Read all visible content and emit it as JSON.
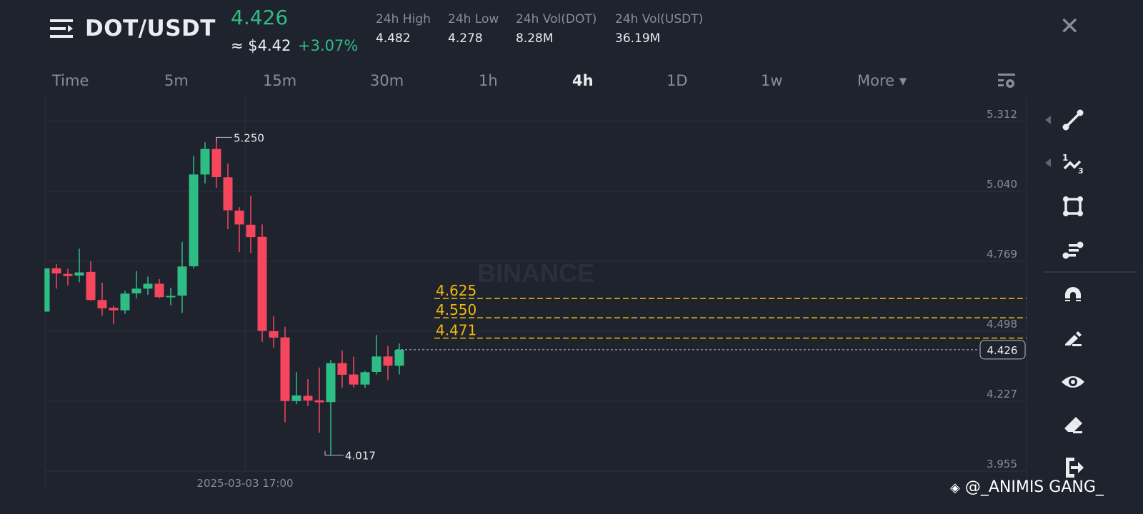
{
  "header": {
    "pair": "DOT/USDT",
    "last_price": "4.426",
    "usd_price": "≈ $4.42",
    "change_pct": "+3.07%",
    "stats": [
      {
        "label": "24h High",
        "value": "4.482"
      },
      {
        "label": "24h Low",
        "value": "4.278"
      },
      {
        "label": "24h Vol(DOT)",
        "value": "8.28M"
      },
      {
        "label": "24h Vol(USDT)",
        "value": "36.19M"
      }
    ],
    "close_label": "✕"
  },
  "tabs": [
    {
      "label": "Time"
    },
    {
      "label": "5m"
    },
    {
      "label": "15m"
    },
    {
      "label": "30m"
    },
    {
      "label": "1h"
    },
    {
      "label": "4h",
      "active": true
    },
    {
      "label": "1D"
    },
    {
      "label": "1w"
    },
    {
      "label": "More ▾"
    }
  ],
  "toolbar": [
    "trend-line",
    "fibonacci",
    "rectangle",
    "parallel-lines",
    "magnet",
    "pencil",
    "eye",
    "eraser",
    "exit"
  ],
  "watermark": {
    "logo": "BINANCE",
    "credit": "@_ANIMIS GANG_"
  },
  "colors": {
    "up": "#2ebd85",
    "down": "#f6465d",
    "level": "#f0b90b",
    "bg": "#1f232e"
  },
  "chart_data": {
    "type": "candlestick",
    "interval": "4h",
    "ylim": [
      3.955,
      5.312
    ],
    "y_ticks": [
      "5.312",
      "5.040",
      "4.769",
      "4.498",
      "4.227",
      "3.955"
    ],
    "x_label": "2025-03-03 17:00",
    "high_marker": "5.250",
    "low_marker": "4.017",
    "current_price": "4.426",
    "levels": [
      "4.625",
      "4.550",
      "4.471"
    ],
    "ohlc": [
      [
        4.574,
        4.742,
        4.574,
        4.742
      ],
      [
        4.742,
        4.758,
        4.663,
        4.722
      ],
      [
        4.72,
        4.74,
        4.675,
        4.712
      ],
      [
        4.714,
        4.818,
        4.688,
        4.726
      ],
      [
        4.728,
        4.769,
        4.617,
        4.619
      ],
      [
        4.619,
        4.686,
        4.558,
        4.587
      ],
      [
        4.589,
        4.596,
        4.525,
        4.579
      ],
      [
        4.579,
        4.655,
        4.565,
        4.644
      ],
      [
        4.645,
        4.731,
        4.625,
        4.663
      ],
      [
        4.663,
        4.71,
        4.639,
        4.682
      ],
      [
        4.682,
        4.7,
        4.626,
        4.63
      ],
      [
        4.632,
        4.667,
        4.599,
        4.635
      ],
      [
        4.636,
        4.845,
        4.569,
        4.749
      ],
      [
        4.75,
        5.178,
        4.742,
        5.106
      ],
      [
        5.106,
        5.231,
        5.071,
        5.205
      ],
      [
        5.205,
        5.25,
        5.054,
        5.096
      ],
      [
        5.095,
        5.148,
        4.894,
        4.967
      ],
      [
        4.966,
        4.979,
        4.805,
        4.912
      ],
      [
        4.911,
        5.024,
        4.8,
        4.863
      ],
      [
        4.864,
        4.912,
        4.456,
        4.499
      ],
      [
        4.498,
        4.556,
        4.434,
        4.473
      ],
      [
        4.474,
        4.515,
        4.145,
        4.227
      ],
      [
        4.227,
        4.339,
        4.215,
        4.249
      ],
      [
        4.247,
        4.312,
        4.207,
        4.229
      ],
      [
        4.23,
        4.357,
        4.104,
        4.222
      ],
      [
        4.223,
        4.387,
        4.017,
        4.374
      ],
      [
        4.374,
        4.423,
        4.279,
        4.329
      ],
      [
        4.33,
        4.399,
        4.279,
        4.291
      ],
      [
        4.291,
        4.344,
        4.278,
        4.339
      ],
      [
        4.34,
        4.483,
        4.33,
        4.4
      ],
      [
        4.4,
        4.441,
        4.309,
        4.364
      ],
      [
        4.364,
        4.45,
        4.33,
        4.426
      ]
    ]
  }
}
